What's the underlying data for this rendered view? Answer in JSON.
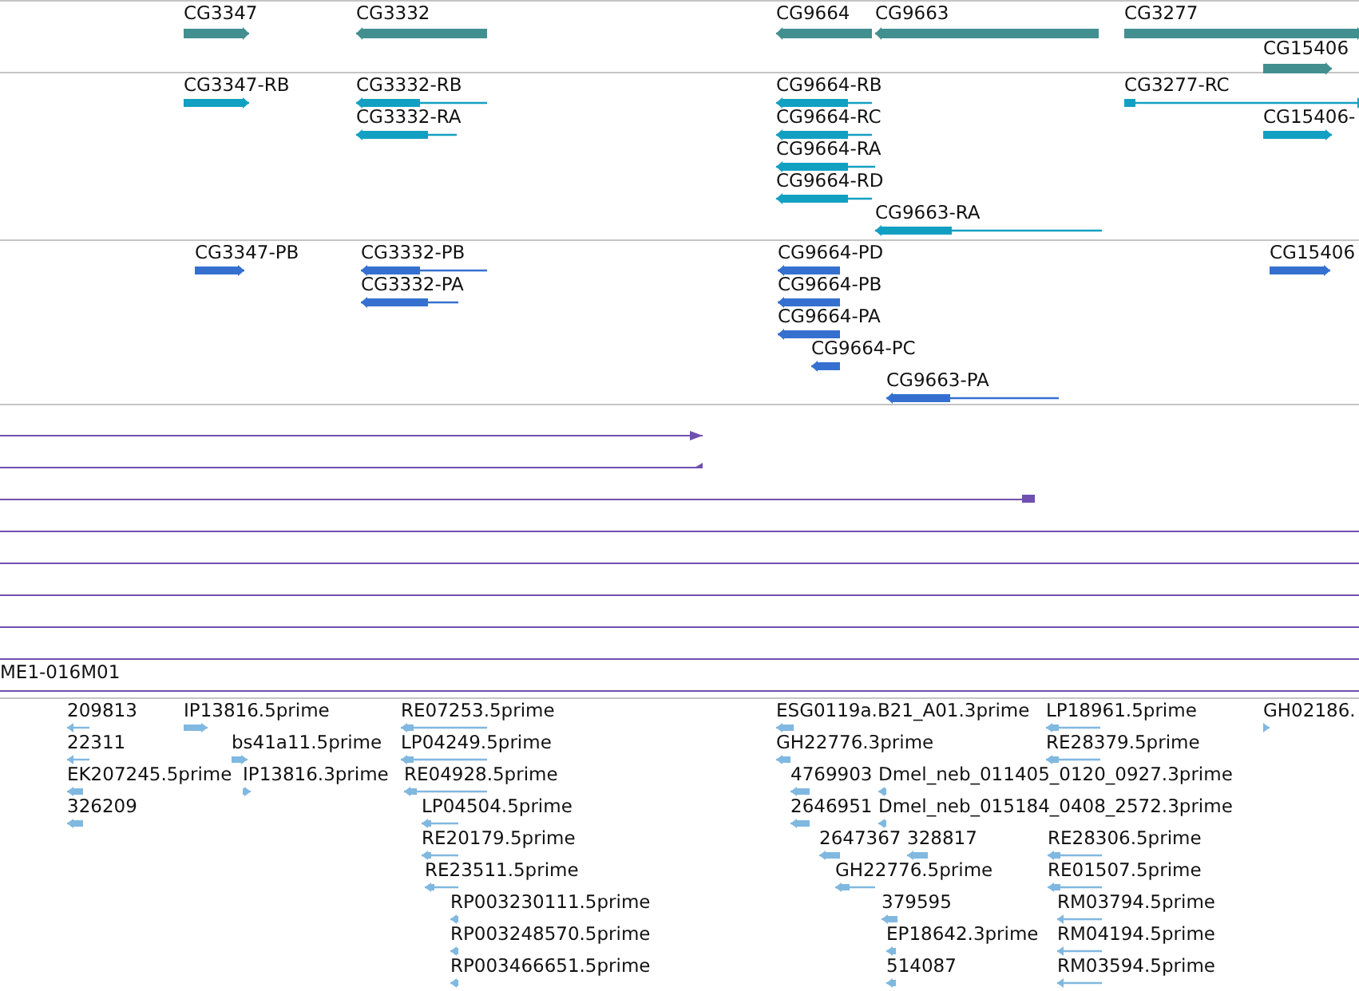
{
  "tracks": [
    {
      "kind": "gene",
      "features": [
        {
          "label": "CG3347",
          "reverse": false
        },
        {
          "label": "CG3332",
          "reverse": true
        },
        {
          "label": "CG9664",
          "reverse": true
        },
        {
          "label": "CG9663",
          "reverse": true
        },
        {
          "label": "CG3277",
          "reverse": false
        },
        {
          "label": "CG15406",
          "reverse": false
        }
      ]
    },
    {
      "kind": "transcript",
      "features": [
        {
          "label": "CG3347-RB",
          "reverse": false
        },
        {
          "label": "CG3332-RB",
          "reverse": true
        },
        {
          "label": "CG3332-RA",
          "reverse": true
        },
        {
          "label": "CG9664-RB",
          "reverse": true
        },
        {
          "label": "CG9664-RC",
          "reverse": true
        },
        {
          "label": "CG9664-RA",
          "reverse": true
        },
        {
          "label": "CG9664-RD",
          "reverse": true
        },
        {
          "label": "CG9663-RA",
          "reverse": true
        },
        {
          "label": "CG3277-RC",
          "reverse": false
        },
        {
          "label": "CG15406-",
          "reverse": false
        }
      ]
    },
    {
      "kind": "protein",
      "features": [
        {
          "label": "CG3347-PB",
          "reverse": false
        },
        {
          "label": "CG3332-PB",
          "reverse": true
        },
        {
          "label": "CG3332-PA",
          "reverse": true
        },
        {
          "label": "CG9664-PD",
          "reverse": true
        },
        {
          "label": "CG9664-PB",
          "reverse": true
        },
        {
          "label": "CG9664-PA",
          "reverse": true
        },
        {
          "label": "CG9664-PC",
          "reverse": true
        },
        {
          "label": "CG9663-PA",
          "reverse": true
        },
        {
          "label": "CG15406",
          "reverse": false
        }
      ]
    },
    {
      "kind": "alignment",
      "label": "ME1-016M01"
    },
    {
      "kind": "est",
      "features": [
        {
          "label": "209813",
          "reverse": true
        },
        {
          "label": "IP13816.5prime",
          "reverse": false
        },
        {
          "label": "RE07253.5prime",
          "reverse": true
        },
        {
          "label": "ESG0119a.B21_A01.3prime",
          "reverse": true
        },
        {
          "label": "LP18961.5prime",
          "reverse": true
        },
        {
          "label": "GH02186.",
          "reverse": false
        },
        {
          "label": "22311",
          "reverse": true
        },
        {
          "label": "bs41a11.5prime",
          "reverse": false
        },
        {
          "label": "LP04249.5prime",
          "reverse": true
        },
        {
          "label": "GH22776.3prime",
          "reverse": true
        },
        {
          "label": "RE28379.5prime",
          "reverse": true
        },
        {
          "label": "EK207245.5prime",
          "reverse": true
        },
        {
          "label": "IP13816.3prime",
          "reverse": false
        },
        {
          "label": "RE04928.5prime",
          "reverse": true
        },
        {
          "label": "4769903",
          "reverse": true
        },
        {
          "label": "Dmel_neb_011405_0120_0927.3prime",
          "reverse": true
        },
        {
          "label": "326209",
          "reverse": true
        },
        {
          "label": "LP04504.5prime",
          "reverse": true
        },
        {
          "label": "2646951",
          "reverse": true
        },
        {
          "label": "Dmel_neb_015184_0408_2572.3prime",
          "reverse": true
        },
        {
          "label": "RE20179.5prime",
          "reverse": true
        },
        {
          "label": "2647367",
          "reverse": true
        },
        {
          "label": "328817",
          "reverse": true
        },
        {
          "label": "RE28306.5prime",
          "reverse": true
        },
        {
          "label": "RE23511.5prime",
          "reverse": true
        },
        {
          "label": "GH22776.5prime",
          "reverse": true
        },
        {
          "label": "RE01507.5prime",
          "reverse": true
        },
        {
          "label": "RP003230111.5prime",
          "reverse": true
        },
        {
          "label": "379595",
          "reverse": true
        },
        {
          "label": "RM03794.5prime",
          "reverse": true
        },
        {
          "label": "RP003248570.5prime",
          "reverse": true
        },
        {
          "label": "EP18642.3prime",
          "reverse": true
        },
        {
          "label": "RM04194.5prime",
          "reverse": true
        },
        {
          "label": "RP003466651.5prime",
          "reverse": true
        },
        {
          "label": "514087",
          "reverse": true
        },
        {
          "label": "RM03594.5prime",
          "reverse": true
        }
      ]
    }
  ]
}
